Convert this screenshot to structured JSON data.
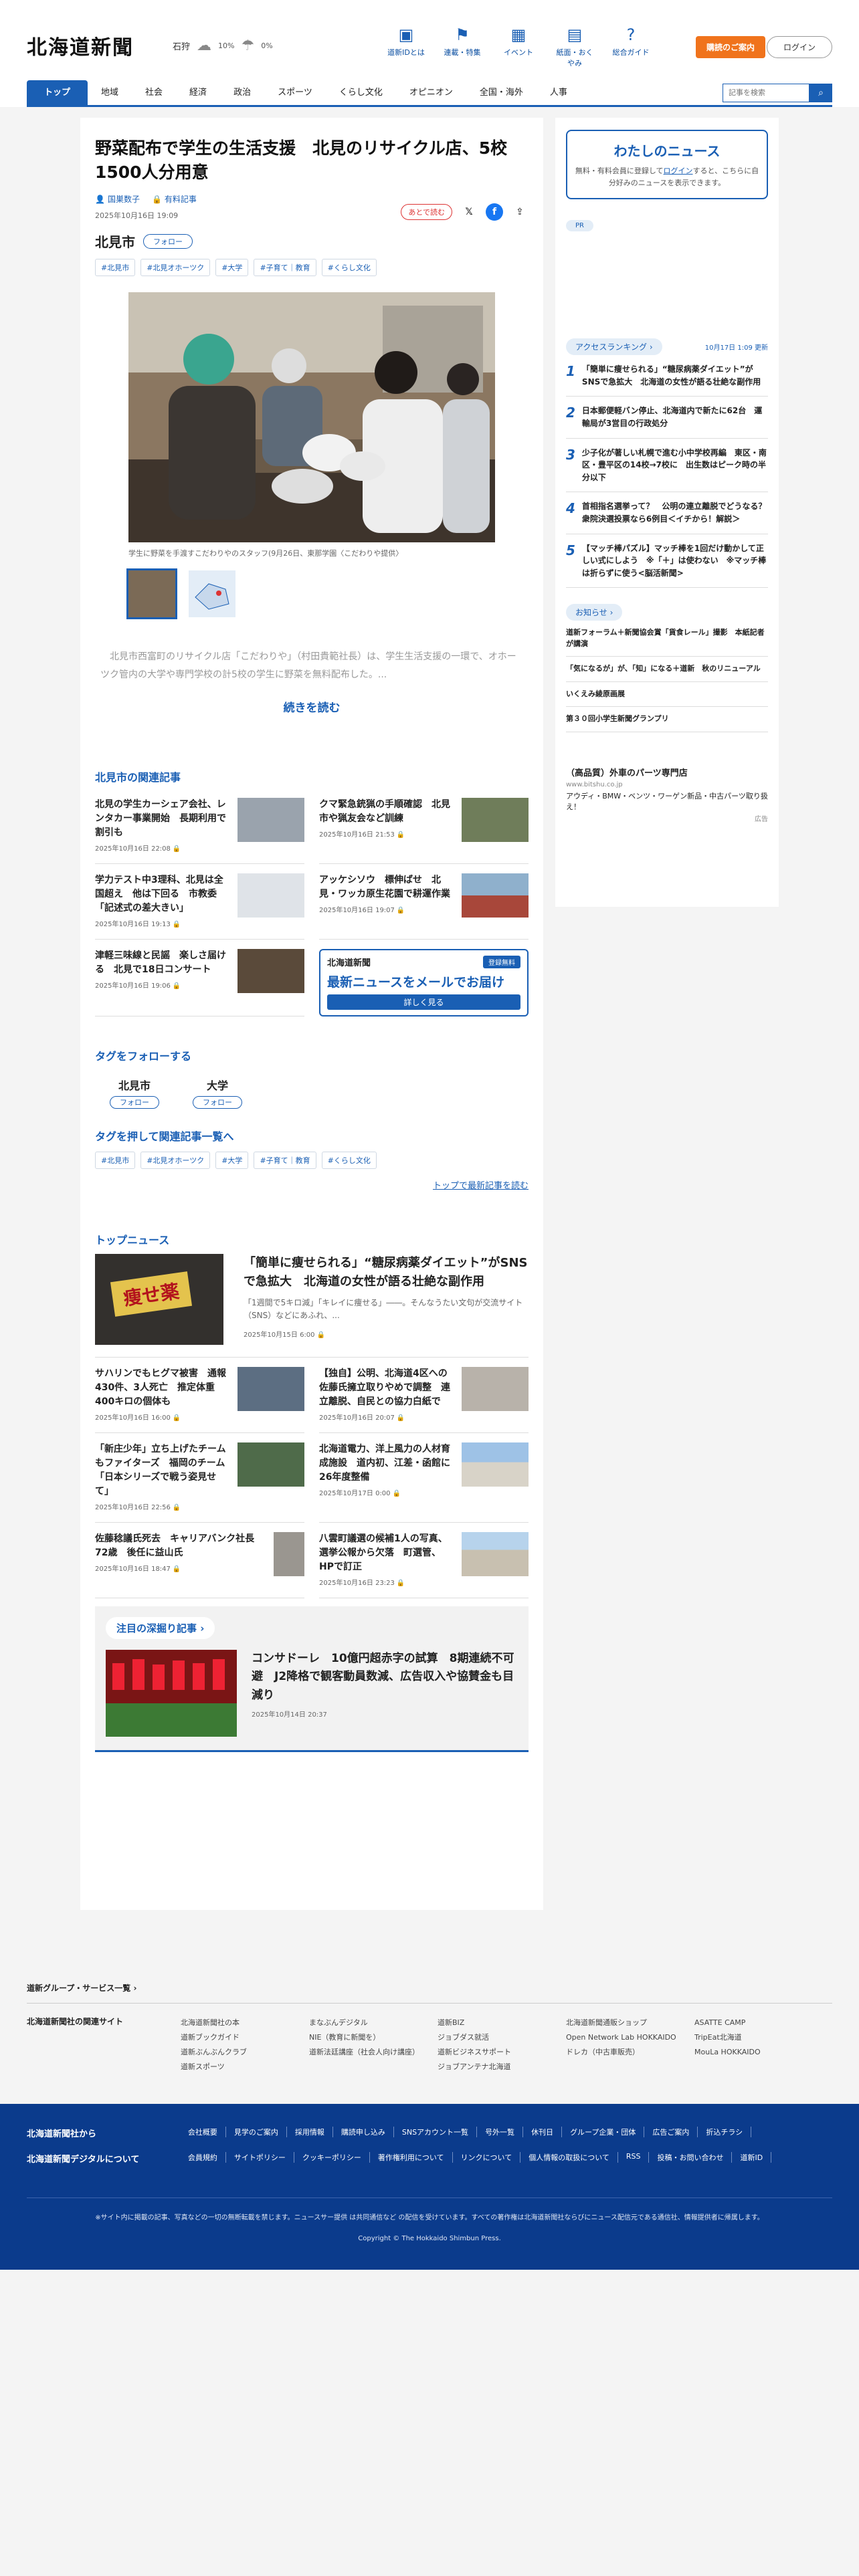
{
  "header": {
    "logo": "北海道新聞",
    "weather": {
      "city": "石狩",
      "percent": "10%",
      "rain": "0%"
    },
    "icons": [
      {
        "label": "道新IDとは",
        "icon": "id-icon"
      },
      {
        "label": "連載・特集",
        "icon": "flag-icon"
      },
      {
        "label": "イベント",
        "icon": "calendar-icon"
      },
      {
        "label": "紙面・おくやみ",
        "icon": "newspaper-icon"
      },
      {
        "label": "総合ガイド",
        "icon": "help-icon"
      }
    ],
    "subscribe": "購読のご案内",
    "login": "ログイン"
  },
  "nav": {
    "items": [
      "トップ",
      "地域",
      "社会",
      "経済",
      "政治",
      "スポーツ",
      "くらし文化",
      "オピニオン",
      "全国・海外",
      "人事"
    ],
    "search_placeholder": "記事を検索"
  },
  "article": {
    "title": "野菜配布で学生の生活支援　北見のリサイクル店、5校1500人分用意",
    "author": "国巣数子",
    "badge": "有料記事",
    "date": "2025年10月16日 19:09",
    "later": "あとで読む",
    "place": "北見市",
    "follow": "フォロー",
    "tags": [
      "#北見市",
      "#北見オホーツク",
      "#大学",
      "#子育て｜教育",
      "#くらし文化"
    ],
    "caption": "学生に野菜を手渡すこだわりやのスタッフ(9月26日、東那学園〈こだわりや提供〉",
    "lead": "　北見市西富町のリサイクル店「こだわりや」（村田貴範社長）は、学生生活支援の一環で、オホーツク管内の大学や専門学校の計5校の学生に野菜を無料配布した。...",
    "readmore": "続きを読む"
  },
  "related": {
    "heading": "北見市の関連記事",
    "items": [
      {
        "title": "北見の学生カーシェア会社、レンタカー事業開始　長期利用で割引も",
        "date": "2025年10月16日 22:08"
      },
      {
        "title": "クマ緊急銃猟の手順確認　北見市や猟友会など訓練",
        "date": "2025年10月16日 21:53"
      },
      {
        "title": "学力テスト中3理科、北見は全国超え　他は下回る　市教委「記述式の差大きい」",
        "date": "2025年10月16日 19:13"
      },
      {
        "title": "アッケシソウ　標伸ばせ　北見・ワッカ原生花園で耕運作業",
        "date": "2025年10月16日 19:07"
      },
      {
        "title": "津軽三味線と民謡　楽しさ届ける　北見で18日コンサート",
        "date": "2025年10月16日 19:06"
      }
    ],
    "mail": {
      "brand": "北海道新聞",
      "free": "登録無料",
      "big": "最新ニュースをメールでお届け",
      "more": "詳しく見る"
    }
  },
  "follow_tags": {
    "heading": "タグをフォローする",
    "items": [
      {
        "name": "北見市",
        "btn": "フォロー"
      },
      {
        "name": "大学",
        "btn": "フォロー"
      }
    ],
    "tagsearch_heading": "タグを押して関連記事一覧へ",
    "tags": [
      "#北見市",
      "#北見オホーツク",
      "#大学",
      "#子育て｜教育",
      "#くらし文化"
    ],
    "latest_link": "トップで最新記事を読む"
  },
  "top_news": {
    "heading": "トップニュース",
    "lead": {
      "title": "「簡単に痩せられる」“糖尿病薬ダイエット”がSNSで急拡大　北海道の女性が語る壮絶な副作用",
      "summary": "「1週間で5キロ減」「キレイに痩せる」――。そんなうたい文句が交流サイト（SNS）などにあふれ、...",
      "date": "2025年10月15日 6:00",
      "img_text": "痩せ薬"
    },
    "items": [
      {
        "title": "サハリンでもヒグマ被害　通報430件、3人死亡　推定体重400キロの個体も",
        "date": "2025年10月16日 16:00"
      },
      {
        "title": "【独自】公明、北海道4区への佐藤氏擁立取りやめで調整　連立離脱、自民との協力白紙で",
        "date": "2025年10月16日 20:07"
      },
      {
        "title": "「新庄少年」立ち上げたチームもファイターズ　福岡のチーム「日本シリーズで戦う姿見せて」",
        "date": "2025年10月16日 22:56"
      },
      {
        "title": "北海道電力、洋上風力の人材育成施設　道内初、江差・函館に26年度整備",
        "date": "2025年10月17日 0:00"
      },
      {
        "title": "佐藤稔議氏死去　キャリアバンク社長　72歳　後任に益山氏",
        "date": "2025年10月16日 18:47"
      },
      {
        "title": "八雲町議選の候補1人の写真、選挙公報から欠落　町選管、HPで訂正",
        "date": "2025年10月16日 23:23"
      }
    ]
  },
  "deep": {
    "heading": "注目の深掘り記事",
    "title": "コンサドーレ　10億円超赤字の試算　8期連続不可避　J2降格で観客動員数減、広告収入や協賛金も目減り",
    "date": "2025年10月14日 20:37"
  },
  "sidebar": {
    "mynews": {
      "title": "わたしのニュース",
      "text_a": "無料・有料会員に登録して",
      "link": "ログイン",
      "text_b": "すると、こちらに自分好みのニュースを表示できます。"
    },
    "pr": "PR",
    "ranking": {
      "label": "アクセスランキング",
      "updated": "10月17日 1:09 更新",
      "items": [
        {
          "n": "1",
          "title": "「簡単に痩せられる」“糖尿病薬ダイエット”がSNSで急拡大　北海道の女性が語る壮絶な副作用"
        },
        {
          "n": "2",
          "title": "日本郵便軽バン停止、北海道内で新たに62台　運輸局が3営目の行政処分"
        },
        {
          "n": "3",
          "title": "少子化が著しい札幌で進む小中学校再編　東区・南区・豊平区の14校→7校に　出生数はピーク時の半分以下"
        },
        {
          "n": "4",
          "title": "首相指名選挙って？　公明の連立離脱でどうなる？　衆院決選投票なら6例目＜イチから！解説＞"
        },
        {
          "n": "5",
          "title": "【マッチ棒パズル】マッチ棒を1回だけ動かして正しい式にしよう　※「＋」は使わない　※マッチ棒は折らずに使う<脳活新聞>"
        }
      ]
    },
    "notice": {
      "label": "お知らせ",
      "items": [
        "道新フォーラム＋新聞協会賞「貨食レール」撮影　本紙記者が講演",
        "「気になるが」が、「知」になる＋道新　秋のリニューアル",
        "いくえみ綾原画展",
        "第３０回小学生新聞グランプリ"
      ]
    },
    "ad": {
      "title": "（高品質）外車のパーツ専門店",
      "url": "www.bitshu.co.jp",
      "text": "アウディ・BMW・ベンツ・ワーゲン新品・中古パーツ取り扱え！",
      "ad_label": "広告"
    }
  },
  "footer": {
    "group": "道新グループ・サービス一覧",
    "related_heading": "北海道新聞社の関連サイト",
    "cols": [
      [
        "北海道新聞社の本",
        "道新ブックガイド",
        "道新ぶんぶんクラブ",
        "道新スポーツ"
      ],
      [
        "まなぶんデジタル",
        "NIE（教育に新聞を）",
        "道新法廷講座（社会人向け講座）"
      ],
      [
        "道新BIZ",
        "ジョブダス就活",
        "道新ビジネスサポート",
        "ジョブアンテナ北海道"
      ],
      [
        "北海道新聞通販ショップ",
        "Open Network Lab HOKKAIDO",
        "ドレカ（中古車販売）"
      ],
      [
        "ASATTE CAMP",
        "TripEat北海道",
        "MouLa HOKKAIDO"
      ]
    ],
    "corp_heading": "北海道新聞社から",
    "corp_links": [
      "会社概要",
      "見学のご案内",
      "採用情報",
      "購読申し込み",
      "SNSアカウント一覧",
      "号外一覧",
      "休刊日",
      "グループ企業・団体",
      "広告ご案内",
      "折込チラシ"
    ],
    "digital_heading": "北海道新聞デジタルについて",
    "digital_links": [
      "会員規約",
      "サイトポリシー",
      "クッキーポリシー",
      "著作権利用について",
      "リンクについて",
      "個人情報の取扱について",
      "RSS",
      "投稿・お問い合わせ",
      "道新ID"
    ],
    "note": "※サイト内に掲載の記事、写真などの一切の無断転載を禁じます。ニュースサー提供 は共同通信など の配信を受けています。すべての著作権は北海道新聞社ならびにニュース配信元である通信社、情報提供者に帰属します。",
    "copyright": "Copyright © The Hokkaido Shimbun Press."
  }
}
